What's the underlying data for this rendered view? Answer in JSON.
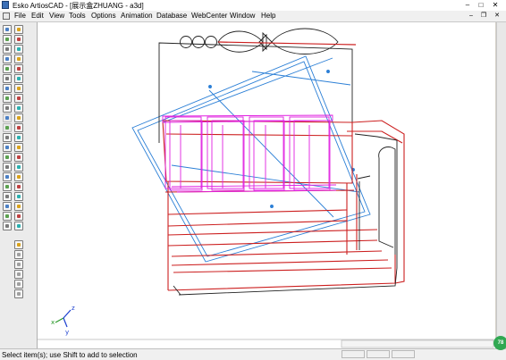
{
  "window": {
    "title": "Esko ArtiosCAD - [展示盒ZHUANG - a3d]"
  },
  "menu": {
    "items": [
      "File",
      "Edit",
      "View",
      "Tools",
      "Options",
      "Animation",
      "Database",
      "WebCenter",
      "Window",
      "Help"
    ]
  },
  "toolbar": {
    "tools": [
      "zoom-in-tool",
      "select-tool",
      "zoom-fit-tool",
      "rotate-tool",
      "zoom-window-tool",
      "pan-tool",
      "zoom-out-tool",
      "view-front-tool",
      "measure-tool",
      "view-top-tool",
      "view-side-tool",
      "fold-tool",
      "eye-tool",
      "shade-tool",
      "reset-tool",
      "orbit-tool",
      "undo-tool",
      "redo-tool",
      "arrow-left-tool",
      "arrow-right-tool",
      "link-tool",
      "box-tool",
      "copy-tool",
      "paste-tool",
      "layer-tool",
      "note-tool",
      "grid-tool",
      "cut-tool",
      "flat-tool",
      "render-tool",
      "align-tool",
      "dimension-tool",
      "snap-tool",
      "print-tool",
      "settings-tool",
      "output-tool",
      "text-tool",
      "mark-tool",
      "label-tool",
      "image-tool",
      "place-tool",
      "export-tool"
    ],
    "lower_tools": [
      "stack-tool-1",
      "stack-tool-2",
      "stack-tool-3",
      "stack-tool-4",
      "stack-tool-5",
      "stack-tool-6"
    ]
  },
  "axis": {
    "x": "x",
    "y": "y",
    "z": "z"
  },
  "status": {
    "message": "Select item(s); use Shift to add to selection"
  },
  "badge": {
    "text": "78"
  },
  "colors": {
    "base_outline": "#cc1f1f",
    "dieline": "#2b7fd6",
    "cells": "#e020e0",
    "dark_outline": "#222222",
    "axis_x": "#2a9a2a",
    "axis_y": "#1b3fcf",
    "axis_z": "#1b3fcf"
  }
}
